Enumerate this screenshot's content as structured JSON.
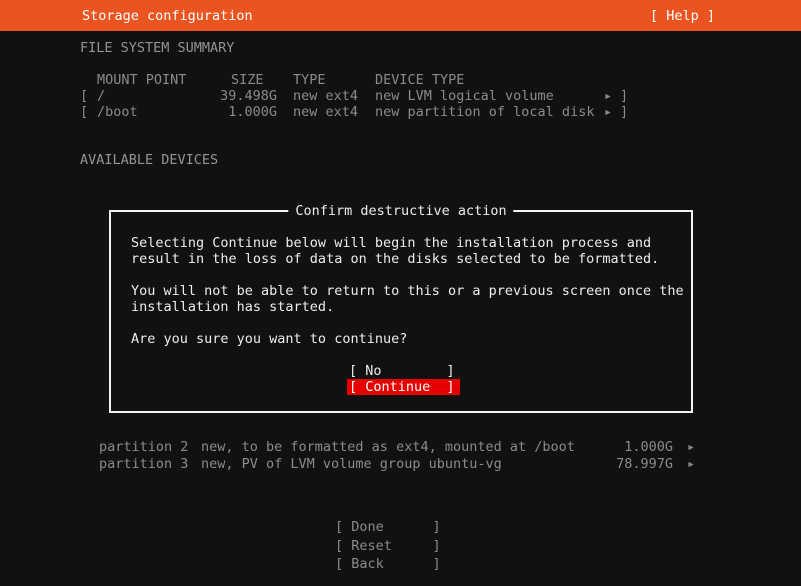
{
  "colors": {
    "accent_orange": "#e95420",
    "danger_red": "#e60000",
    "background": "#111111",
    "dim_text": "#8b8b8b",
    "bright_text": "#ededed"
  },
  "titlebar": {
    "title": "Storage configuration",
    "help": "[ Help ]"
  },
  "headings": {
    "filesystem_summary": "FILE SYSTEM SUMMARY",
    "available_devices": "AVAILABLE DEVICES"
  },
  "summary_table": {
    "headers": {
      "mount": "MOUNT POINT",
      "size": "SIZE",
      "type": "TYPE",
      "device": "DEVICE TYPE"
    },
    "rows": [
      {
        "bracket_open": "[",
        "mount": "/",
        "size": "39.498G",
        "type": "new ext4",
        "device": "new LVM logical volume",
        "arrow": "▸",
        "bracket_close": "]"
      },
      {
        "bracket_open": "[",
        "mount": "/boot",
        "size": "1.000G",
        "type": "new ext4",
        "device": "new partition of local disk",
        "arrow": "▸",
        "bracket_close": "]"
      }
    ]
  },
  "dialog": {
    "title": "Confirm destructive action",
    "lines": [
      "Selecting Continue below will begin the installation process and",
      "result in the loss of data on the disks selected to be formatted.",
      "You will not be able to return to this or a previous screen once the",
      "installation has started.",
      "Are you sure you want to continue?"
    ],
    "no_button": "[ No        ]",
    "continue_button": "[ Continue  ]"
  },
  "partitions": [
    {
      "label": "partition 2",
      "detail": "new, to be formatted as ext4, mounted at /boot",
      "size": "1.000G",
      "arrow": "▸"
    },
    {
      "label": "partition 3",
      "detail": "new, PV of LVM volume group ubuntu-vg",
      "size": "78.997G",
      "arrow": "▸"
    }
  ],
  "footer_buttons": {
    "done": "[ Done      ]",
    "reset": "[ Reset     ]",
    "back": "[ Back      ]"
  }
}
